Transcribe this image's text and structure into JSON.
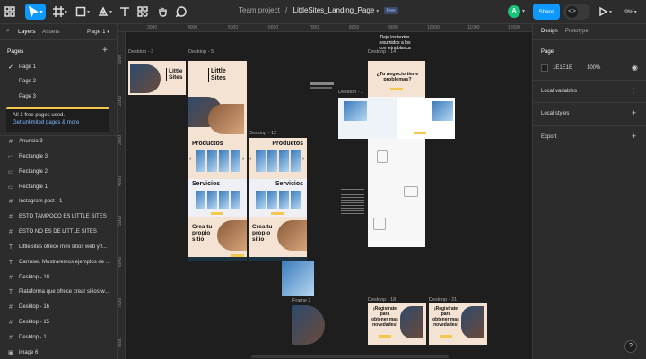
{
  "topbar": {
    "project": "Team project",
    "separator": "/",
    "file_name": "LittleSites_Landing_Page",
    "plan_badge": "Free",
    "avatar_letter": "A",
    "share_label": "Share",
    "zoom": "9%"
  },
  "left_panel": {
    "tab_layers": "Layers",
    "tab_assets": "Assets",
    "page_selector": "Page 1",
    "pages_heading": "Pages",
    "pages": [
      "Page 1",
      "Page 2",
      "Page 3"
    ],
    "notice_line1": "All 3 free pages used.",
    "notice_link": "Get unlimited pages & more",
    "layers": [
      {
        "icon": "#",
        "label": "Anuncio 3"
      },
      {
        "icon": "▭",
        "label": "Rectangle 3"
      },
      {
        "icon": "▭",
        "label": "Rectangle 2"
      },
      {
        "icon": "▭",
        "label": "Rectangle 1"
      },
      {
        "icon": "#",
        "label": "Instagram post - 1"
      },
      {
        "icon": "#",
        "label": "ESTO TAMPOCO ES LITTLE SITES"
      },
      {
        "icon": "#",
        "label": "ESTO NO ES DE LITTLE SITES"
      },
      {
        "icon": "T",
        "label": "LittleSites ofrece mini sitios web y f..."
      },
      {
        "icon": "T",
        "label": "Carrusel. Mostraremos ejemplos de ..."
      },
      {
        "icon": "#",
        "label": "Desktop - 18"
      },
      {
        "icon": "T",
        "label": "Plataforma que ofrece crear sitios w..."
      },
      {
        "icon": "#",
        "label": "Desktop - 16"
      },
      {
        "icon": "#",
        "label": "Desktop - 15"
      },
      {
        "icon": "#",
        "label": "Desktop - 1"
      },
      {
        "icon": "▣",
        "label": "image 6"
      }
    ]
  },
  "rulers": {
    "x": [
      "3000",
      "4000",
      "5000",
      "6000",
      "7000",
      "8000",
      "9000",
      "10000",
      "11000",
      "12000"
    ],
    "y": [
      "3000",
      "2000",
      "3000",
      "4000",
      "5000",
      "6000",
      "7000",
      "8000",
      "9000",
      "10000"
    ]
  },
  "canvas": {
    "frame_labels": {
      "d3": "Desktop - 3",
      "d5": "Desktop - 5",
      "d14": "Desktop - 14",
      "d1": "Desktop - 1",
      "d12": "Desktop - 12",
      "d18": "Desktop - 18",
      "d21": "Desktop - 21",
      "frame2": "Frame 2"
    },
    "texts": {
      "little_sites": "Little Sites",
      "productos": "Productos",
      "servicios": "Servicios",
      "crea": "Crea tu propio sitio",
      "negocio": "¿Tu negocio tiene problemas?",
      "note": "Dejo los textos resumidos a los con letra blanca",
      "registrate": "¡Registrate para obtener mas novedades!"
    }
  },
  "right_panel": {
    "tab_design": "Design",
    "tab_prototype": "Prototype",
    "page_heading": "Page",
    "bg_hex": "1E1E1E",
    "bg_opacity": "100%",
    "local_variables": "Local variables",
    "local_styles": "Local styles",
    "export": "Export",
    "help": "?"
  },
  "colors": {
    "accent": "#0d99ff",
    "canvas_bg": "#1E1E1E",
    "frame_bg": "#f4e3d3",
    "cta_yellow": "#f2c94c",
    "avatar_green": "#1bc47d"
  }
}
